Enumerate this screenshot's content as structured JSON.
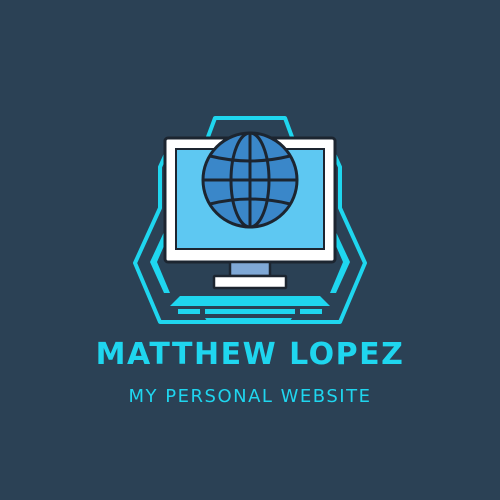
{
  "logo": {
    "name": "MATTHEW LOPEZ",
    "tagline": "MY PERSONAL WEBSITE",
    "icon": "computer-globe-icon"
  },
  "colors": {
    "background": "#2b4155",
    "accent": "#1fd6ef",
    "screen": "#5ec8f2",
    "globe": "#3a87c9",
    "outline": "#1c2530"
  }
}
